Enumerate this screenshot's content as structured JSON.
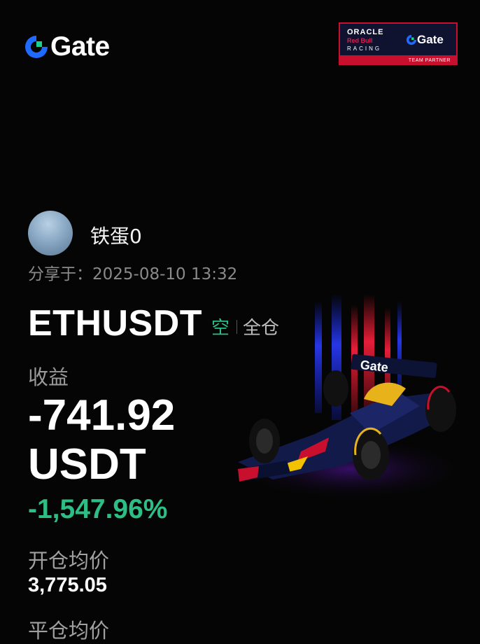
{
  "brand": {
    "logo_text": "Gate",
    "accent": "#1f6bff"
  },
  "partner_badge": {
    "oracle": "ORACLE",
    "red_bull": "Red Bull",
    "racing": "RACING",
    "gate": "Gate",
    "partner": "TEAM PARTNER"
  },
  "user": {
    "name": "铁蛋0",
    "shared_at": "分享于：2025-08-10 13:32"
  },
  "position": {
    "symbol": "ETHUSDT",
    "side": "空",
    "margin_mode": "全仓",
    "pnl_label": "收益",
    "pnl_value": "-741.92",
    "pnl_unit": "USDT",
    "pnl_percent": "-1,547.96%",
    "entry_label": "开仓均价",
    "entry_price": "3,775.05",
    "exit_label": "平仓均价"
  },
  "car_livery_text": "Gate",
  "colors": {
    "positive": "#2ebd85",
    "background": "#050505",
    "badge_red": "#c8102e",
    "badge_navy": "#0f1330"
  }
}
